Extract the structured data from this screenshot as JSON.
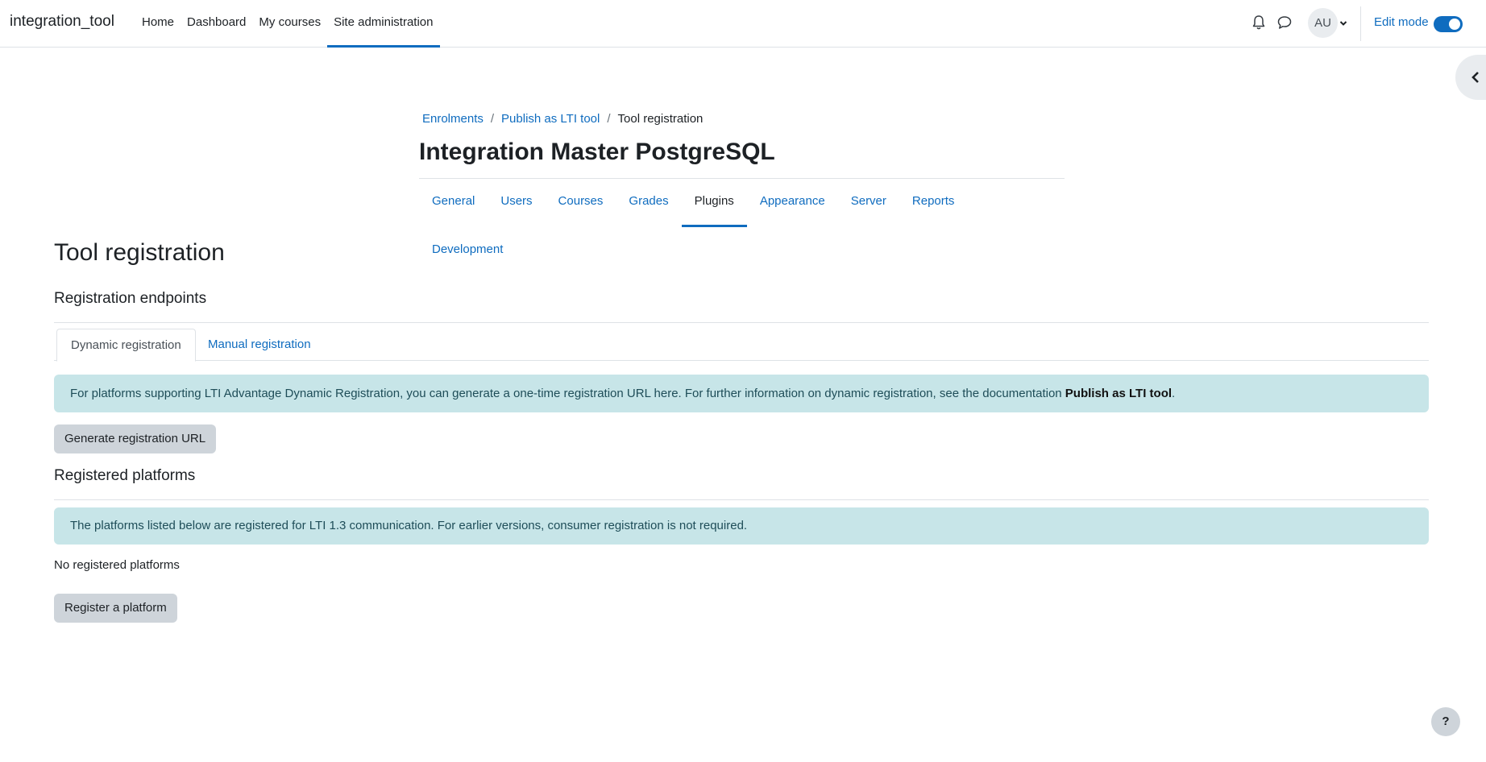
{
  "navbar": {
    "brand": "integration_tool",
    "items": [
      {
        "label": "Home",
        "active": false
      },
      {
        "label": "Dashboard",
        "active": false
      },
      {
        "label": "My courses",
        "active": false
      },
      {
        "label": "Site administration",
        "active": true
      }
    ],
    "avatar_initials": "AU",
    "edit_mode_label": "Edit mode",
    "edit_mode_on": true,
    "icons": [
      "bell-icon",
      "chat-icon",
      "chevron-down-icon"
    ]
  },
  "header": {
    "breadcrumb": [
      {
        "label": "Enrolments",
        "link": true
      },
      {
        "label": "Publish as LTI tool",
        "link": true
      },
      {
        "label": "Tool registration",
        "link": false
      }
    ],
    "breadcrumb_separator": "/",
    "title": "Integration Master PostgreSQL",
    "secondary_nav": [
      {
        "label": "General",
        "active": false
      },
      {
        "label": "Users",
        "active": false
      },
      {
        "label": "Courses",
        "active": false
      },
      {
        "label": "Grades",
        "active": false
      },
      {
        "label": "Plugins",
        "active": true
      },
      {
        "label": "Appearance",
        "active": false
      },
      {
        "label": "Server",
        "active": false
      },
      {
        "label": "Reports",
        "active": false
      },
      {
        "label": "Development",
        "active": false
      }
    ]
  },
  "main": {
    "title": "Tool registration",
    "endpoints_heading": "Registration endpoints",
    "tabs": [
      {
        "label": "Dynamic registration",
        "active": true
      },
      {
        "label": "Manual registration",
        "active": false
      }
    ],
    "dynamic_info_text": "For platforms supporting LTI Advantage Dynamic Registration, you can generate a one-time registration URL here. For further information on dynamic registration, see the documentation ",
    "dynamic_info_link": "Publish as LTI tool",
    "dynamic_info_end": ".",
    "generate_button": "Generate registration URL",
    "registered_heading": "Registered platforms",
    "registered_info": "The platforms listed below are registered for LTI 1.3 communication. For earlier versions, consumer registration is not required.",
    "no_platforms": "No registered platforms",
    "register_button": "Register a platform"
  },
  "help_button": "?",
  "colors": {
    "accent": "#0f6cbf",
    "alert_bg": "#c7e5e8",
    "button_bg": "#ced4da"
  }
}
